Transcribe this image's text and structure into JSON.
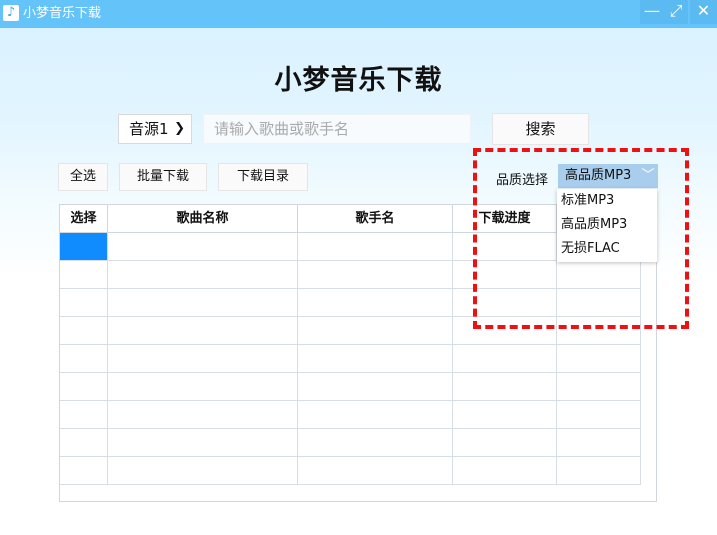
{
  "window": {
    "title": "小梦音乐下载",
    "buttons": {
      "minimize": "—",
      "maximize": "⤢",
      "close": "✕"
    }
  },
  "main": {
    "title": "小梦音乐下载"
  },
  "search": {
    "source_value": "音源1",
    "placeholder": "请输入歌曲或歌手名",
    "button_label": "搜索"
  },
  "toolbar": {
    "select_all": "全选",
    "batch_download": "批量下载",
    "download_dir": "下载目录"
  },
  "quality": {
    "label": "品质选择",
    "selected": "高品质MP3",
    "options": [
      "标准MP3",
      "高品质MP3",
      "无损FLAC"
    ]
  },
  "table": {
    "columns": [
      "选择",
      "歌曲名称",
      "歌手名",
      "下载进度",
      ""
    ],
    "row_count": 9
  },
  "icons": {
    "app": "music-note-icon",
    "chevron": "chevron-down-icon"
  },
  "colors": {
    "titlebar": "#64c3f8",
    "selection": "#118cff",
    "highlight": "#ee1111"
  }
}
